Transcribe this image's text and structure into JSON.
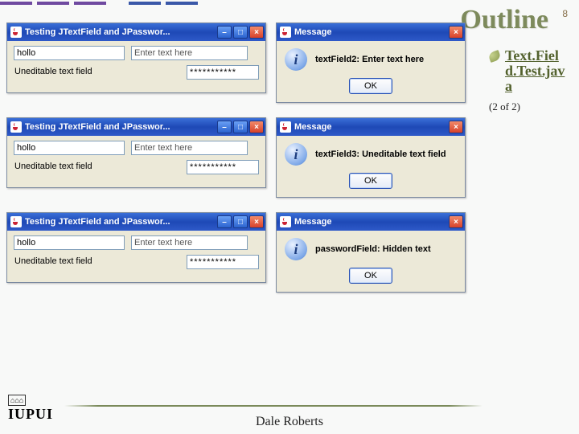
{
  "slide": {
    "title": "Outline",
    "number": "8",
    "file_label": "Text.Field.Test.java",
    "pager": "(2 of 2)",
    "footer": "Dale Roberts",
    "logo_top": "⌂⌂⌂",
    "logo_bot": "IUPUI"
  },
  "accent_colors": [
    "#6f4aa0",
    "#6f4aa0",
    "#6f4aa0",
    "#3a58a8",
    "#3a58a8"
  ],
  "app_window": {
    "title": "Testing JTextField and JPasswor...",
    "field1_value": "hollo",
    "field2_value": "Enter text here",
    "uneditable_label": "Uneditable text field",
    "password_value": "***********",
    "min_label": "–",
    "max_label": "□",
    "close_label": "×"
  },
  "dialogs": [
    {
      "title": "Message",
      "text": "textField2: Enter text here",
      "ok": "OK"
    },
    {
      "title": "Message",
      "text": "textField3: Uneditable text field",
      "ok": "OK"
    },
    {
      "title": "Message",
      "text": "passwordField: Hidden text",
      "ok": "OK"
    }
  ]
}
